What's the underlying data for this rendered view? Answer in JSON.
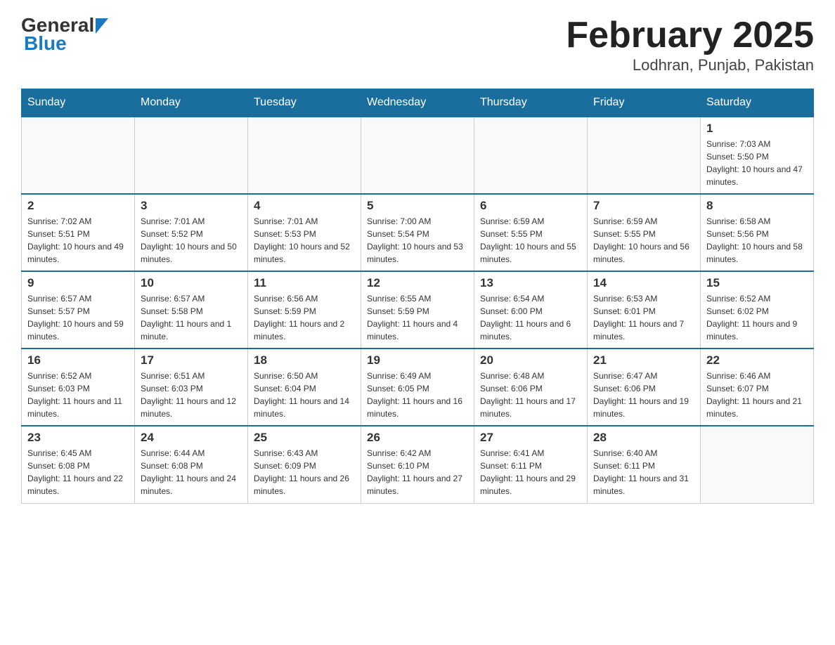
{
  "header": {
    "logo_general": "General",
    "logo_blue": "Blue",
    "month_title": "February 2025",
    "location": "Lodhran, Punjab, Pakistan"
  },
  "weekdays": [
    "Sunday",
    "Monday",
    "Tuesday",
    "Wednesday",
    "Thursday",
    "Friday",
    "Saturday"
  ],
  "weeks": [
    [
      {
        "day": "",
        "info": ""
      },
      {
        "day": "",
        "info": ""
      },
      {
        "day": "",
        "info": ""
      },
      {
        "day": "",
        "info": ""
      },
      {
        "day": "",
        "info": ""
      },
      {
        "day": "",
        "info": ""
      },
      {
        "day": "1",
        "info": "Sunrise: 7:03 AM\nSunset: 5:50 PM\nDaylight: 10 hours and 47 minutes."
      }
    ],
    [
      {
        "day": "2",
        "info": "Sunrise: 7:02 AM\nSunset: 5:51 PM\nDaylight: 10 hours and 49 minutes."
      },
      {
        "day": "3",
        "info": "Sunrise: 7:01 AM\nSunset: 5:52 PM\nDaylight: 10 hours and 50 minutes."
      },
      {
        "day": "4",
        "info": "Sunrise: 7:01 AM\nSunset: 5:53 PM\nDaylight: 10 hours and 52 minutes."
      },
      {
        "day": "5",
        "info": "Sunrise: 7:00 AM\nSunset: 5:54 PM\nDaylight: 10 hours and 53 minutes."
      },
      {
        "day": "6",
        "info": "Sunrise: 6:59 AM\nSunset: 5:55 PM\nDaylight: 10 hours and 55 minutes."
      },
      {
        "day": "7",
        "info": "Sunrise: 6:59 AM\nSunset: 5:55 PM\nDaylight: 10 hours and 56 minutes."
      },
      {
        "day": "8",
        "info": "Sunrise: 6:58 AM\nSunset: 5:56 PM\nDaylight: 10 hours and 58 minutes."
      }
    ],
    [
      {
        "day": "9",
        "info": "Sunrise: 6:57 AM\nSunset: 5:57 PM\nDaylight: 10 hours and 59 minutes."
      },
      {
        "day": "10",
        "info": "Sunrise: 6:57 AM\nSunset: 5:58 PM\nDaylight: 11 hours and 1 minute."
      },
      {
        "day": "11",
        "info": "Sunrise: 6:56 AM\nSunset: 5:59 PM\nDaylight: 11 hours and 2 minutes."
      },
      {
        "day": "12",
        "info": "Sunrise: 6:55 AM\nSunset: 5:59 PM\nDaylight: 11 hours and 4 minutes."
      },
      {
        "day": "13",
        "info": "Sunrise: 6:54 AM\nSunset: 6:00 PM\nDaylight: 11 hours and 6 minutes."
      },
      {
        "day": "14",
        "info": "Sunrise: 6:53 AM\nSunset: 6:01 PM\nDaylight: 11 hours and 7 minutes."
      },
      {
        "day": "15",
        "info": "Sunrise: 6:52 AM\nSunset: 6:02 PM\nDaylight: 11 hours and 9 minutes."
      }
    ],
    [
      {
        "day": "16",
        "info": "Sunrise: 6:52 AM\nSunset: 6:03 PM\nDaylight: 11 hours and 11 minutes."
      },
      {
        "day": "17",
        "info": "Sunrise: 6:51 AM\nSunset: 6:03 PM\nDaylight: 11 hours and 12 minutes."
      },
      {
        "day": "18",
        "info": "Sunrise: 6:50 AM\nSunset: 6:04 PM\nDaylight: 11 hours and 14 minutes."
      },
      {
        "day": "19",
        "info": "Sunrise: 6:49 AM\nSunset: 6:05 PM\nDaylight: 11 hours and 16 minutes."
      },
      {
        "day": "20",
        "info": "Sunrise: 6:48 AM\nSunset: 6:06 PM\nDaylight: 11 hours and 17 minutes."
      },
      {
        "day": "21",
        "info": "Sunrise: 6:47 AM\nSunset: 6:06 PM\nDaylight: 11 hours and 19 minutes."
      },
      {
        "day": "22",
        "info": "Sunrise: 6:46 AM\nSunset: 6:07 PM\nDaylight: 11 hours and 21 minutes."
      }
    ],
    [
      {
        "day": "23",
        "info": "Sunrise: 6:45 AM\nSunset: 6:08 PM\nDaylight: 11 hours and 22 minutes."
      },
      {
        "day": "24",
        "info": "Sunrise: 6:44 AM\nSunset: 6:08 PM\nDaylight: 11 hours and 24 minutes."
      },
      {
        "day": "25",
        "info": "Sunrise: 6:43 AM\nSunset: 6:09 PM\nDaylight: 11 hours and 26 minutes."
      },
      {
        "day": "26",
        "info": "Sunrise: 6:42 AM\nSunset: 6:10 PM\nDaylight: 11 hours and 27 minutes."
      },
      {
        "day": "27",
        "info": "Sunrise: 6:41 AM\nSunset: 6:11 PM\nDaylight: 11 hours and 29 minutes."
      },
      {
        "day": "28",
        "info": "Sunrise: 6:40 AM\nSunset: 6:11 PM\nDaylight: 11 hours and 31 minutes."
      },
      {
        "day": "",
        "info": ""
      }
    ]
  ]
}
